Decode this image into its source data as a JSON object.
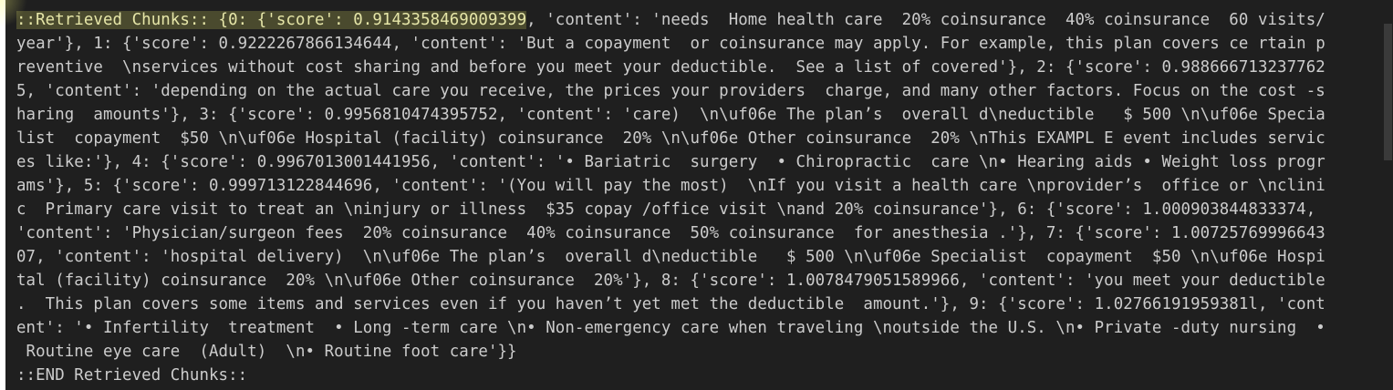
{
  "terminal": {
    "lines": [
      {
        "pre": "",
        "highlight": "::Retrieved Chunks:: {0: {'score': 0.9143358469009399",
        "post": ", 'content': 'needs  Home health care  20% coinsurance  40% coinsurance  60 visits/"
      },
      {
        "pre": "year'}, 1: {'score': 0.9222267866134644, 'content': 'But a copayment  or coinsurance may apply. For example, this plan covers ce rtain p",
        "highlight": "",
        "post": ""
      },
      {
        "pre": "reventive  \\nservices without cost sharing and before you meet your deductible.  See a list of covered'}, 2: {'score': 0.988666713237762",
        "highlight": "",
        "post": ""
      },
      {
        "pre": "5, 'content': 'depending on the actual care you receive, the prices your providers  charge, and many other factors. Focus on the cost -s",
        "highlight": "",
        "post": ""
      },
      {
        "pre": "haring  amounts'}, 3: {'score': 0.9956810474395752, 'content': 'care)  \\n\\uf06e The plan’s  overall d\\neductible   $ 500 \\n\\uf06e Specia",
        "highlight": "",
        "post": ""
      },
      {
        "pre": "list  copayment  $50 \\n\\uf06e Hospital (facility) coinsurance  20% \\n\\uf06e Other coinsurance  20% \\nThis EXAMPL E event includes servic",
        "highlight": "",
        "post": ""
      },
      {
        "pre": "es like:'}, 4: {'score': 0.9967013001441956, 'content': '• Bariatric  surgery  • Chiropractic  care \\n• Hearing aids • Weight loss progr",
        "highlight": "",
        "post": ""
      },
      {
        "pre": "ams'}, 5: {'score': 0.999713122844696, 'content': '(You will pay the most)  \\nIf you visit a health care \\nprovider’s  office or \\nclini",
        "highlight": "",
        "post": ""
      },
      {
        "pre": "c  Primary care visit to treat an \\ninjury or illness  $35 copay /office visit \\nand 20% coinsurance'}, 6: {'score': 1.000903844833374,",
        "highlight": "",
        "post": ""
      },
      {
        "pre": "'content': 'Physician/surgeon fees  20% coinsurance  40% coinsurance  50% coinsurance  for anesthesia .'}, 7: {'score': 1.00725769996643",
        "highlight": "",
        "post": ""
      },
      {
        "pre": "07, 'content': 'hospital delivery)  \\n\\uf06e The plan’s  overall d\\neductible   $ 500 \\n\\uf06e Specialist  copayment  $50 \\n\\uf06e Hospi",
        "highlight": "",
        "post": ""
      },
      {
        "pre": "tal (facility) coinsurance  20% \\n\\uf06e Other coinsurance  20%'}, 8: {'score': 1.0078479051589966, 'content': 'you meet your deductible",
        "highlight": "",
        "post": ""
      },
      {
        "pre": ".  This plan covers some items and services even if you haven’t yet met the deductible  amount.'}, 9: {'score': 1.02766191959381l, 'cont",
        "highlight": "",
        "post": ""
      },
      {
        "pre": "ent': '• Infertility  treatment  • Long -term care \\n• Non-emergency care when traveling \\noutside the U.S. \\n• Private -duty nursing  •",
        "highlight": "",
        "post": ""
      },
      {
        "pre": " Routine eye care  (Adult)  \\n• Routine foot care'}}",
        "highlight": "",
        "post": ""
      },
      {
        "pre": "::END Retrieved Chunks::",
        "highlight": "",
        "post": ""
      }
    ]
  },
  "colors": {
    "background": "#1f1f1f",
    "text": "#cccccc",
    "highlight_bg": "#4a4a2e"
  }
}
